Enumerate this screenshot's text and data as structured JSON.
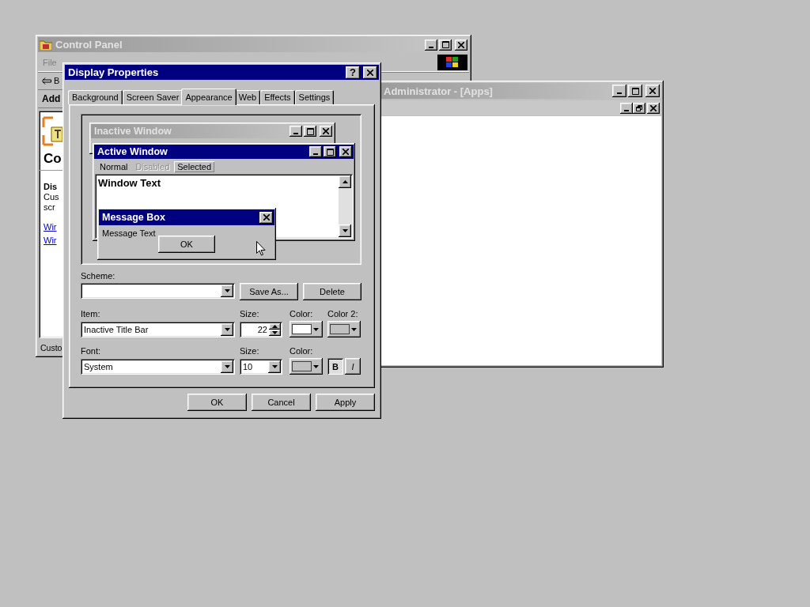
{
  "control_panel": {
    "title": "Control Panel",
    "active": false,
    "menu": [
      "File"
    ],
    "toolbar": "B",
    "address_label": "Add",
    "heading": "Co",
    "section_title": "Dis",
    "description": [
      "Cus",
      "scr"
    ],
    "links": [
      "Wir",
      "Wir"
    ],
    "status": "Custo"
  },
  "apps_window": {
    "title": "Administrator - [Apps]",
    "active": false
  },
  "dialog": {
    "title": "Display Properties",
    "active": true,
    "help": "?",
    "tabs": [
      {
        "label": "Background",
        "selected": false
      },
      {
        "label": "Screen Saver",
        "selected": false
      },
      {
        "label": "Appearance",
        "selected": true
      },
      {
        "label": "Web",
        "selected": false
      },
      {
        "label": "Effects",
        "selected": false
      },
      {
        "label": "Settings",
        "selected": false
      }
    ],
    "preview": {
      "inactive_title": "Inactive Window",
      "active_title": "Active Window",
      "menu": [
        {
          "label": "Normal",
          "selected": false,
          "disabled": false
        },
        {
          "label": "Disabled",
          "selected": false,
          "disabled": true
        },
        {
          "label": "Selected",
          "selected": true,
          "disabled": false
        }
      ],
      "window_text": "Window Text",
      "message_box": {
        "title": "Message Box",
        "text": "Message Text",
        "button": "OK"
      }
    },
    "scheme": {
      "label": "Scheme:"
    },
    "scheme_buttons": [
      "Save As...",
      "Delete"
    ],
    "item": {
      "label": "Item:",
      "value": "Inactive Title Bar"
    },
    "item_size": {
      "label": "Size:",
      "value": "22"
    },
    "item_color": {
      "label": "Color:",
      "color": "#ffffff"
    },
    "item_color2": {
      "label": "Color 2:",
      "color": "#c0c0c0"
    },
    "font": {
      "label": "Font:",
      "value": "System"
    },
    "font_size": {
      "label": "Size:",
      "value": "10"
    },
    "font_color": {
      "label": "Color:",
      "color": "#c0c0c0"
    },
    "styles": [
      {
        "label": "B",
        "kind": "bold",
        "on": true
      },
      {
        "label": "I",
        "kind": "italic",
        "on": false
      }
    ],
    "buttons": [
      "OK",
      "Cancel",
      "Apply"
    ]
  }
}
